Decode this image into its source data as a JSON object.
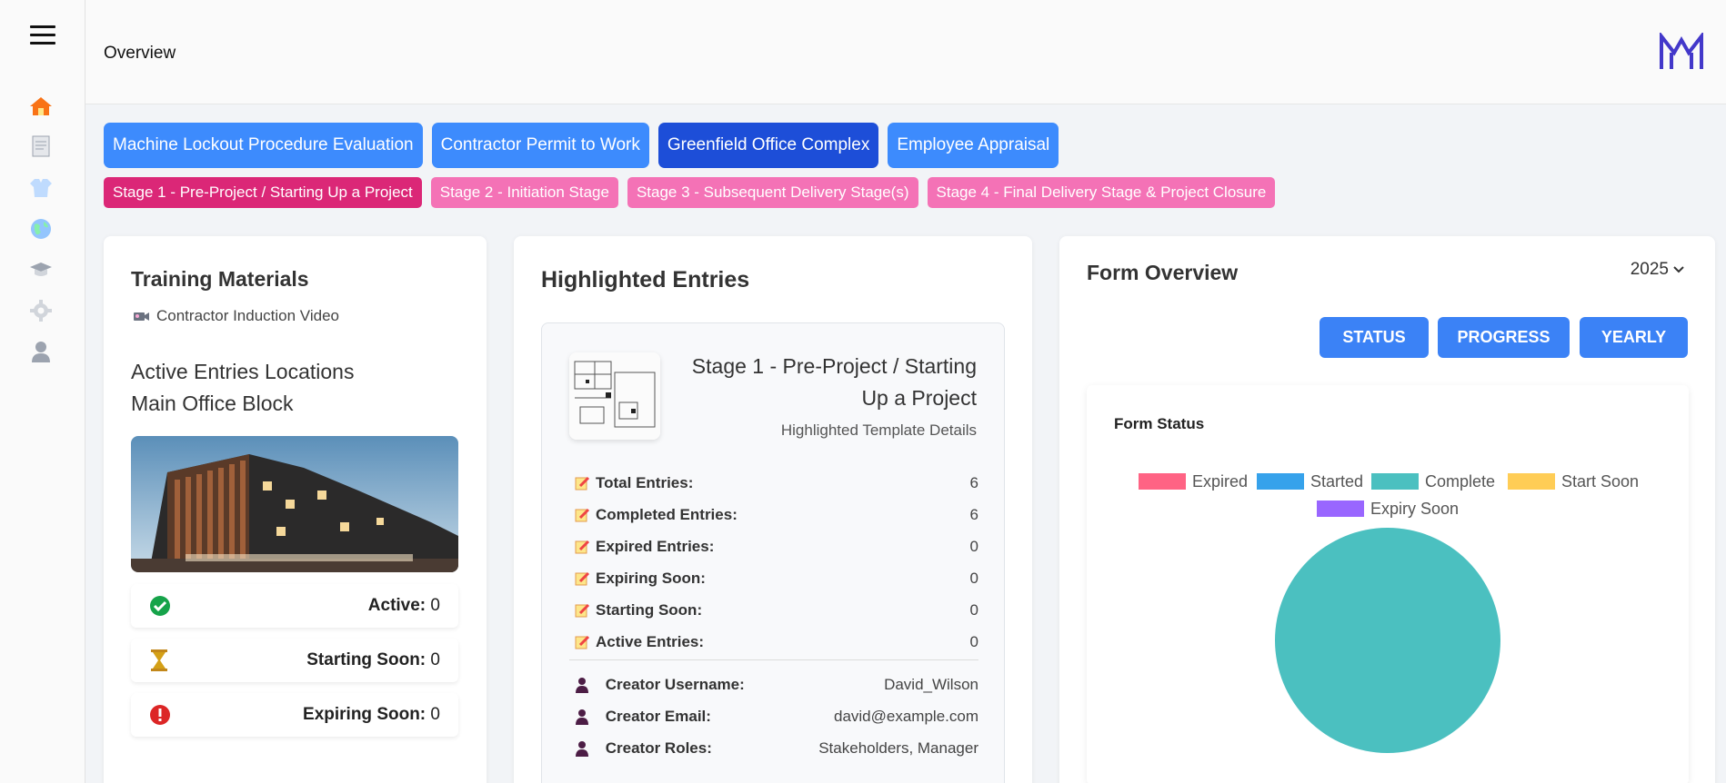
{
  "header": {
    "title": "Overview"
  },
  "sidebar": {
    "items": [
      {
        "icon": "home-icon",
        "label": "Home"
      },
      {
        "icon": "document-icon",
        "label": "Documents"
      },
      {
        "icon": "uniform-icon",
        "label": "Uniform"
      },
      {
        "icon": "globe-icon",
        "label": "Globe"
      },
      {
        "icon": "graduation-cap-icon",
        "label": "Training"
      },
      {
        "icon": "gear-icon",
        "label": "Settings"
      },
      {
        "icon": "user-icon",
        "label": "Profile"
      }
    ]
  },
  "tabs": [
    {
      "label": "Machine Lockout Procedure Evaluation",
      "active": false
    },
    {
      "label": "Contractor Permit to Work",
      "active": false
    },
    {
      "label": "Greenfield Office Complex",
      "active": true
    },
    {
      "label": "Employee Appraisal",
      "active": false
    }
  ],
  "stages": [
    {
      "label": "Stage 1 - Pre-Project / Starting Up a Project",
      "active": true
    },
    {
      "label": "Stage 2 - Initiation Stage",
      "active": false
    },
    {
      "label": "Stage 3 - Subsequent Delivery Stage(s)",
      "active": false
    },
    {
      "label": "Stage 4 - Final Delivery Stage & Project Closure",
      "active": false
    }
  ],
  "training": {
    "title": "Training Materials",
    "video": "Contractor Induction Video",
    "locations_title": "Active Entries Locations",
    "location": "Main Office Block",
    "stats": [
      {
        "label": "Active:",
        "value": "0",
        "icon": "check-circle-icon",
        "color": "#16a34a"
      },
      {
        "label": "Starting Soon:",
        "value": "0",
        "icon": "hourglass-icon",
        "color": "#d4a017"
      },
      {
        "label": "Expiring Soon:",
        "value": "0",
        "icon": "alert-circle-icon",
        "color": "#dc2626"
      }
    ]
  },
  "highlighted": {
    "title": "Highlighted Entries",
    "stage": "Stage 1 - Pre-Project / Starting Up a Project",
    "subtitle": "Highlighted Template Details",
    "entries": [
      {
        "label": "Total Entries:",
        "value": "6"
      },
      {
        "label": "Completed Entries:",
        "value": "6"
      },
      {
        "label": "Expired Entries:",
        "value": "0"
      },
      {
        "label": "Expiring Soon:",
        "value": "0"
      },
      {
        "label": "Starting Soon:",
        "value": "0"
      },
      {
        "label": "Active Entries:",
        "value": "0"
      }
    ],
    "creator": [
      {
        "label": "Creator Username:",
        "value": "David_Wilson"
      },
      {
        "label": "Creator Email:",
        "value": "david@example.com"
      },
      {
        "label": "Creator Roles:",
        "value": "Stakeholders, Manager"
      }
    ]
  },
  "form_overview": {
    "title": "Form Overview",
    "year": "2025",
    "buttons": [
      "STATUS",
      "PROGRESS",
      "YEARLY"
    ]
  },
  "chart_data": {
    "type": "pie",
    "title": "Form Status",
    "legend_position": "top",
    "categories": [
      "Expired",
      "Started",
      "Complete",
      "Start Soon",
      "Expiry Soon"
    ],
    "values": [
      0,
      0,
      6,
      0,
      0
    ],
    "colors": [
      "#ff6384",
      "#36a2eb",
      "#4bc0c0",
      "#ffcd56",
      "#9966ff"
    ]
  },
  "colors": {
    "accent": "#3d8bfd",
    "accent_active": "#1d4ed8",
    "stage": "#f472b6",
    "stage_active": "#db2777"
  }
}
